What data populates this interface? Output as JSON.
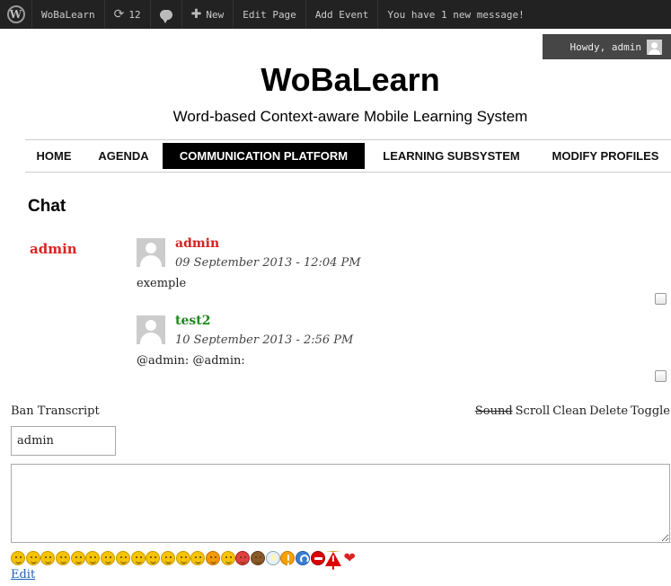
{
  "admin_bar": {
    "site_name": "WoBaLearn",
    "updates_count": "12",
    "new_label": "New",
    "edit_page_label": "Edit Page",
    "add_event_label": "Add Event",
    "notice": "You have 1 new message!",
    "howdy": "Howdy, admin"
  },
  "header": {
    "site_title": "WoBaLearn",
    "tagline": "Word-based Context-aware Mobile Learning System"
  },
  "nav": {
    "items": [
      {
        "label": "HOME"
      },
      {
        "label": "AGENDA"
      },
      {
        "label": "COMMUNICATION PLATFORM",
        "active": true
      },
      {
        "label": "LEARNING SUBSYSTEM"
      },
      {
        "label": "MODIFY PROFILES"
      }
    ]
  },
  "chat": {
    "title": "Chat",
    "online_users": [
      "admin"
    ],
    "messages": [
      {
        "author": "admin",
        "author_color": "#d22222",
        "time": "09 September 2013 - 12:04 PM",
        "text": "exemple"
      },
      {
        "author": "test2",
        "author_color": "#1a8a1a",
        "time": "10 September 2013 - 2:56 PM",
        "text": "@admin: @admin:"
      }
    ],
    "ban_transcript": "Ban Transcript",
    "controls": {
      "sound": "Sound",
      "scroll": "Scroll",
      "clean": "Clean",
      "delete": "Delete",
      "toggle": "Toggle"
    },
    "name_value": "admin",
    "message_value": "",
    "emoticons": [
      "smile-icon",
      "sad-icon",
      "wink-icon",
      "tongue-icon",
      "grin-icon",
      "neutral-icon",
      "surprised-icon",
      "confused-icon",
      "nerd-icon",
      "dizzy-icon",
      "cool-icon",
      "laugh-icon",
      "cry-icon",
      "shocked-icon",
      "happy-icon",
      "evil-icon",
      "monkey-icon",
      "idea-icon",
      "exclamation-icon",
      "question-icon",
      "no-entry-icon",
      "warning-icon",
      "heart-icon"
    ],
    "edit_label": "Edit"
  }
}
